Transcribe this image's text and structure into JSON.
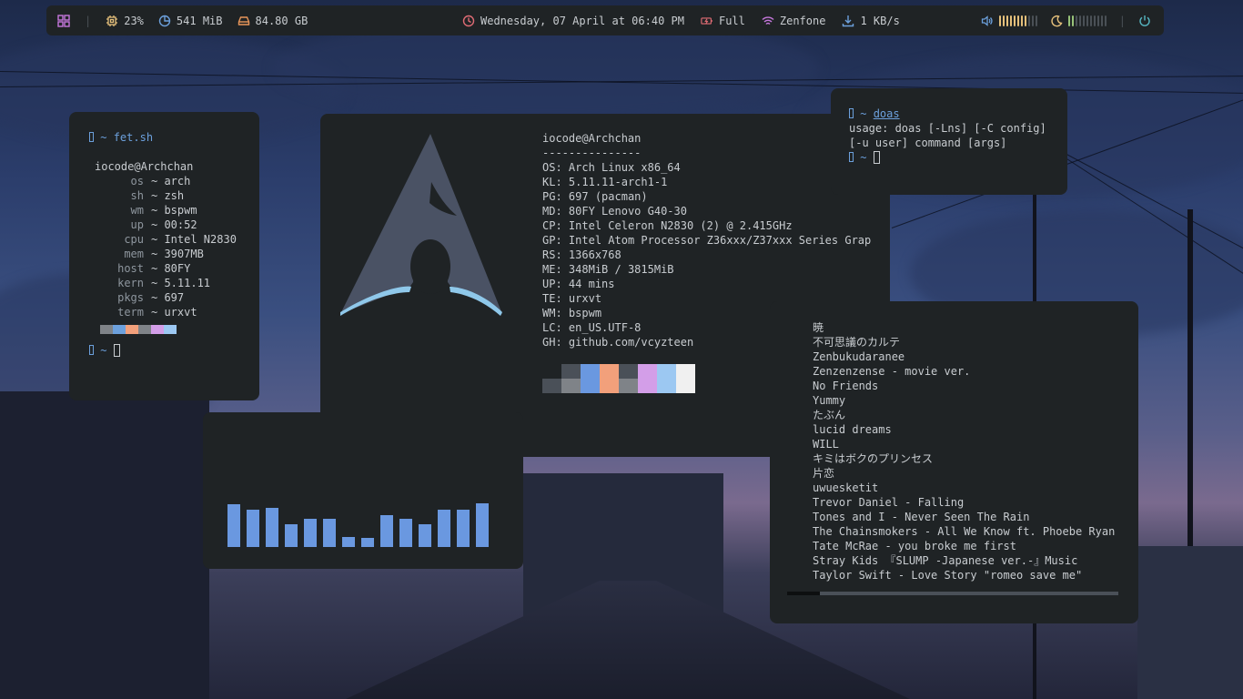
{
  "statusbar": {
    "cpu": "23%",
    "memory": "541 MiB",
    "disk": "84.80 GB",
    "datetime": "Wednesday, 07 April at 06:40 PM",
    "battery": "Full",
    "wifi": "Zenfone",
    "network_speed": "1 KB/s",
    "volume_level": 0.7,
    "brightness_level": 0.2,
    "colors": {
      "cpu": "#e5c07b",
      "memory": "#6ca0dc",
      "disk": "#e8965a",
      "clock": "#e06c75",
      "battery": "#e06c75",
      "wifi": "#c678dd",
      "download": "#6ca0dc",
      "volume": "#6ca0dc",
      "volume_ticks": "#e5c07b",
      "brightness": "#e5c07b",
      "brightness_ticks": "#98c379",
      "power": "#56b6c2"
    }
  },
  "fet": {
    "prompt_symbol": "~",
    "command": "fet.sh",
    "user_host": "iocode@Archchan",
    "rows": [
      {
        "label": "os",
        "value": "~ arch"
      },
      {
        "label": "sh",
        "value": "~ zsh"
      },
      {
        "label": "wm",
        "value": "~ bspwm"
      },
      {
        "label": "up",
        "value": "~ 00:52"
      },
      {
        "label": "cpu",
        "value": "~ Intel  N2830"
      },
      {
        "label": "mem",
        "value": "~ 3907MB"
      },
      {
        "label": "host",
        "value": "~ 80FY"
      },
      {
        "label": "kern",
        "value": "~ 5.11.11"
      },
      {
        "label": "pkgs",
        "value": "~ 697"
      },
      {
        "label": "term",
        "value": "~ urxvt"
      }
    ],
    "swatch_colors": [
      "#7f8388",
      "#6ca0dc",
      "#f2a07b",
      "#7f8388",
      "#d39ee8",
      "#9cc8f2"
    ]
  },
  "neofetch": {
    "user_host": "iocode@Archchan",
    "separator": "---------------",
    "rows": [
      {
        "key": "OS:",
        "value": "Arch Linux x86_64"
      },
      {
        "key": "KL:",
        "value": "5.11.11-arch1-1"
      },
      {
        "key": "PG:",
        "value": "697 (pacman)"
      },
      {
        "key": "MD:",
        "value": "80FY Lenovo G40-30"
      },
      {
        "key": "CP:",
        "value": "Intel Celeron N2830 (2) @ 2.415GHz"
      },
      {
        "key": "GP:",
        "value": "Intel Atom Processor Z36xxx/Z37xxx Series Grap"
      },
      {
        "key": "RS:",
        "value": "1366x768"
      },
      {
        "key": "ME:",
        "value": "348MiB / 3815MiB"
      },
      {
        "key": "UP:",
        "value": "44 mins"
      },
      {
        "key": "TE:",
        "value": "urxvt"
      },
      {
        "key": "WM:",
        "value": "bspwm"
      },
      {
        "key": "LC:",
        "value": "en_US.UTF-8"
      },
      {
        "key": "GH:",
        "value": "github.com/vcyzteen"
      }
    ],
    "palette_top": [
      "#1f2325",
      "#4a5058",
      "#6a98e0",
      "#f2a07b",
      "#4a5058",
      "#d39ee8",
      "#9cc8f2",
      "#f0f0f0"
    ],
    "palette_bottom": [
      "#4a5058",
      "#7f8388",
      "#6a98e0",
      "#f2a07b",
      "#7f8388",
      "#d39ee8",
      "#9cc8f2",
      "#f0f0f0"
    ]
  },
  "doas": {
    "prompt_symbol": "~",
    "command": "doas",
    "output_line1": "usage: doas [-Lns] [-C config]",
    "output_line2": "[-u user] command [args]"
  },
  "visualizer": {
    "levels": [
      0.47,
      0.41,
      0.43,
      0.25,
      0.31,
      0.31,
      0.11,
      0.1,
      0.35,
      0.31,
      0.25,
      0.41,
      0.41,
      0.48
    ],
    "color": "#6a98e0"
  },
  "music": {
    "tracks": [
      "暁",
      "不可思議のカルテ",
      "Zenbukudaranee",
      "Zenzenzense - movie ver.",
      "No Friends",
      "Yummy",
      "たぶん",
      "lucid dreams",
      "WILL",
      "キミはボクのプリンセス",
      "片恋",
      "uwuesketit",
      "Trevor Daniel - Falling",
      "Tones and I - Never Seen The Rain",
      "The Chainsmokers - All We Know ft. Phoebe Ryan",
      "Tate McRae - you broke me first",
      "Stray Kids 『SLUMP -Japanese ver.-』Music",
      "Taylor Swift - Love Story \"romeo save me\""
    ],
    "progress": 0.1
  }
}
